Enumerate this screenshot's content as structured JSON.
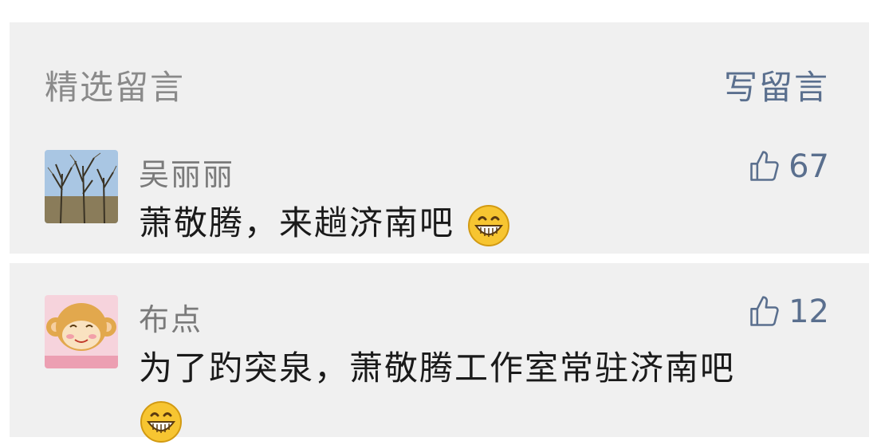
{
  "header": {
    "title": "精选留言",
    "write_label": "写留言"
  },
  "comments": [
    {
      "nickname": "吴丽丽",
      "content": "萧敬腾，来趟济南吧",
      "likes": "67",
      "emoji": "grinning-face-icon"
    },
    {
      "nickname": "布点",
      "content": "为了趵突泉，萧敬腾工作室常驻济南吧",
      "likes": "12",
      "emoji": "grinning-face-icon"
    }
  ],
  "colors": {
    "panel_bg": "#f0f0f0",
    "link": "#5a6f8e",
    "muted": "#8a8a8a",
    "text": "#1a1a1a"
  }
}
